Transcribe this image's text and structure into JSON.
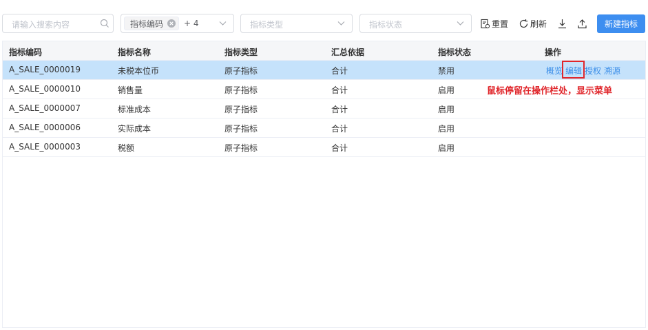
{
  "filters": {
    "search_placeholder": "请输入搜索内容",
    "code_tag": "指标编码",
    "code_more": "+ 4",
    "type_placeholder": "指标类型",
    "state_placeholder": "指标状态"
  },
  "toolbar": {
    "reset": "重置",
    "refresh": "刷新",
    "new": "新建指标"
  },
  "table": {
    "headers": [
      "指标编码",
      "指标名称",
      "指标类型",
      "汇总依据",
      "指标状态",
      "操作"
    ],
    "rows": [
      [
        "A_SALE_0000019",
        "未税本位币",
        "原子指标",
        "合计",
        "禁用"
      ],
      [
        "A_SALE_0000010",
        "销售量",
        "原子指标",
        "合计",
        "启用"
      ],
      [
        "A_SALE_0000007",
        "标准成本",
        "原子指标",
        "合计",
        "启用"
      ],
      [
        "A_SALE_0000006",
        "实际成本",
        "原子指标",
        "合计",
        "启用"
      ],
      [
        "A_SALE_0000003",
        "税额",
        "原子指标",
        "合计",
        "启用"
      ]
    ],
    "actions": [
      "概览",
      "编辑",
      "授权",
      "溯源"
    ]
  },
  "annotation": "鼠标停留在操作栏处，显示菜单",
  "colors": {
    "primary": "#3d8ef0",
    "selected_row": "#c5e2fb",
    "link": "#3b8ee8",
    "annotation": "#e0262b"
  }
}
